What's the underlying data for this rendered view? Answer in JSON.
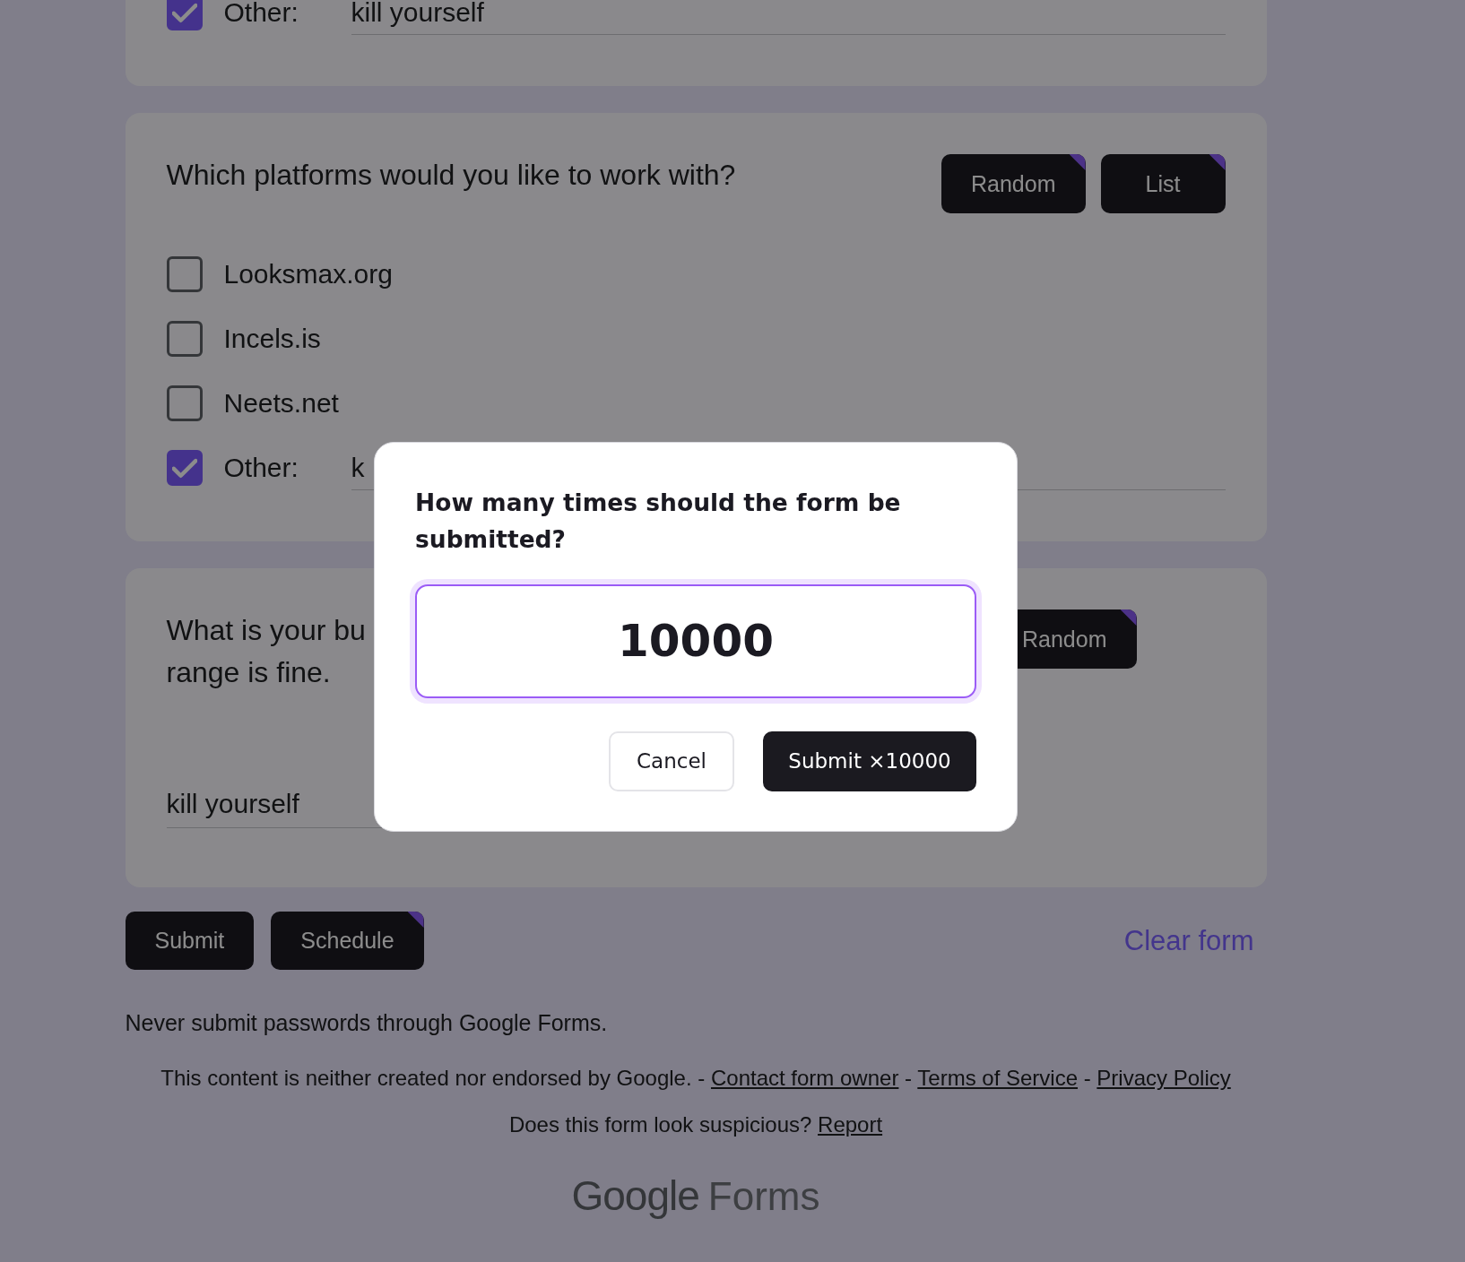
{
  "form": {
    "questions": [
      {
        "kind": "checkboxes",
        "options": [
          {
            "label": "Other:",
            "checked": true,
            "other_answer": "kill yourself"
          }
        ]
      },
      {
        "kind": "checkboxes",
        "title_lines": [
          "Which platforms would you like to work with?"
        ],
        "actions": [
          {
            "label": "Random",
            "corner_mark": true
          },
          {
            "label": "List",
            "corner_mark": true
          }
        ],
        "options": [
          {
            "label": "Looksmax.org",
            "checked": false
          },
          {
            "label": "Incels.is",
            "checked": false
          },
          {
            "label": "Neets.net",
            "checked": false
          },
          {
            "label": "Other:",
            "checked": true,
            "other_answer": "k"
          }
        ]
      },
      {
        "kind": "short_answer",
        "title_lines": [
          "What is your bu",
          "range is fine."
        ],
        "actions": [
          {
            "label": "Random",
            "corner_mark": true
          }
        ],
        "answer": "kill yourself"
      }
    ],
    "buttons": [
      {
        "label": "Submit",
        "corner_mark": false
      },
      {
        "label": "Schedule",
        "corner_mark": true
      }
    ],
    "clear_link": "Clear form",
    "password_warning": "Never submit passwords through Google Forms.",
    "disclaimer": {
      "text": "This content is neither created nor endorsed by Google.",
      "links": [
        {
          "separator": "-",
          "label": "Contact form owner"
        },
        {
          "separator": "-",
          "label": "Terms of Service"
        },
        {
          "separator": "-",
          "label": "Privacy Policy"
        }
      ]
    },
    "report": {
      "text": "Does this form look suspicious?",
      "link": "Report"
    },
    "logo": {
      "brand": "Google",
      "product": "Forms"
    }
  },
  "dialog": {
    "title": "How many times should the form be submitted?",
    "count_field": {
      "value": "10000",
      "focused": true
    },
    "buttons": [
      {
        "label": "Cancel",
        "kind": "secondary"
      },
      {
        "label": "Submit ×10000",
        "kind": "primary"
      }
    ]
  }
}
